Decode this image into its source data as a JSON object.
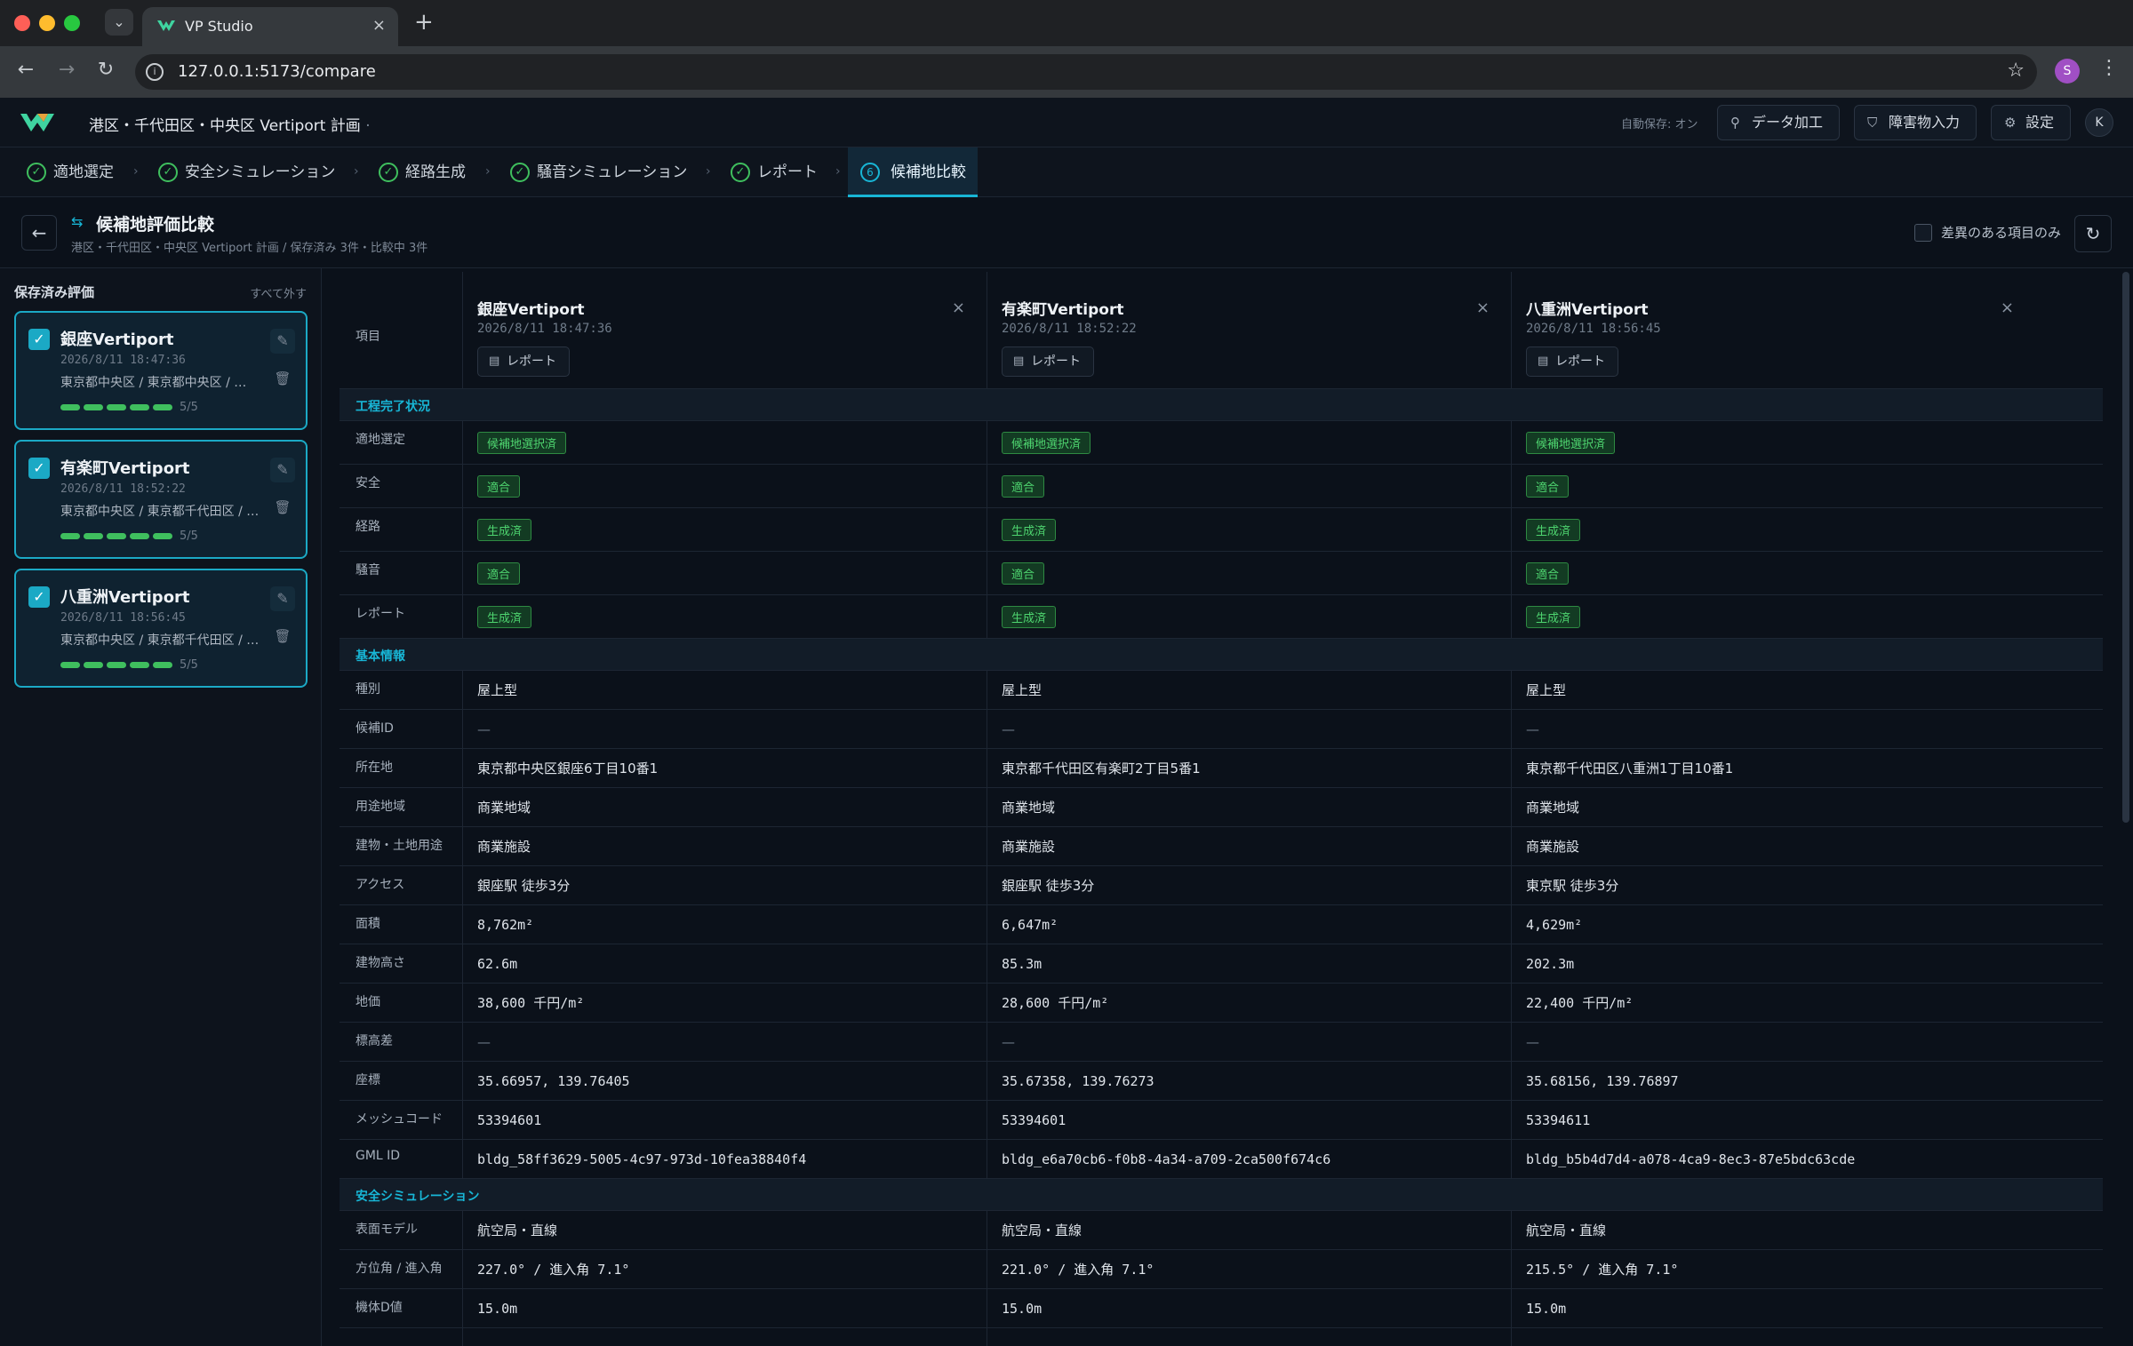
{
  "browser": {
    "tab_title": "VP Studio",
    "url": "127.0.0.1:5173/compare"
  },
  "app": {
    "project": "港区・千代田区・中央区 Vertiport 計画",
    "autosave": "自動保存: オン",
    "buttons": {
      "data": "データ加工",
      "obstacle": "障害物入力",
      "settings": "設定"
    },
    "avatar": "K",
    "profile": "S"
  },
  "steps": [
    {
      "label": "適地選定"
    },
    {
      "label": "安全シミュレーション"
    },
    {
      "label": "経路生成"
    },
    {
      "label": "騒音シミュレーション"
    },
    {
      "label": "レポート"
    },
    {
      "label": "候補地比較",
      "num": "6"
    }
  ],
  "page": {
    "title": "候補地評価比較",
    "subtitle": "港区・千代田区・中央区 Vertiport 計画 / 保存済み 3件・比較中 3件",
    "diff_only": "差異のある項目のみ"
  },
  "sidebar": {
    "title": "保存済み評価",
    "clear_all": "すべて外す",
    "cards": [
      {
        "name": "銀座Vertiport",
        "date": "2026/8/11 18:47:36",
        "addr": "東京都中央区 / 東京都中央区 / …",
        "progress": "5/5"
      },
      {
        "name": "有楽町Vertiport",
        "date": "2026/8/11 18:52:22",
        "addr": "東京都中央区 / 東京都千代田区 / …",
        "progress": "5/5"
      },
      {
        "name": "八重洲Vertiport",
        "date": "2026/8/11 18:56:45",
        "addr": "東京都中央区 / 東京都千代田区 / …",
        "progress": "5/5"
      }
    ]
  },
  "table": {
    "item_label": "項目",
    "report_btn": "レポート",
    "columns": [
      {
        "name": "銀座Vertiport",
        "date": "2026/8/11 18:47:36"
      },
      {
        "name": "有楽町Vertiport",
        "date": "2026/8/11 18:52:22"
      },
      {
        "name": "八重洲Vertiport",
        "date": "2026/8/11 18:56:45"
      }
    ],
    "sections": [
      {
        "title": "工程完了状況",
        "rows": [
          {
            "label": "適地選定",
            "badge": true,
            "values": [
              "候補地選択済",
              "候補地選択済",
              "候補地選択済"
            ]
          },
          {
            "label": "安全",
            "badge": true,
            "values": [
              "適合",
              "適合",
              "適合"
            ]
          },
          {
            "label": "経路",
            "badge": true,
            "values": [
              "生成済",
              "生成済",
              "生成済"
            ]
          },
          {
            "label": "騒音",
            "badge": true,
            "values": [
              "適合",
              "適合",
              "適合"
            ]
          },
          {
            "label": "レポート",
            "badge": true,
            "values": [
              "生成済",
              "生成済",
              "生成済"
            ]
          }
        ]
      },
      {
        "title": "基本情報",
        "rows": [
          {
            "label": "種別",
            "values": [
              "屋上型",
              "屋上型",
              "屋上型"
            ]
          },
          {
            "label": "候補ID",
            "values": [
              "—",
              "—",
              "—"
            ]
          },
          {
            "label": "所在地",
            "values": [
              "東京都中央区銀座6丁目10番1",
              "東京都千代田区有楽町2丁目5番1",
              "東京都千代田区八重洲1丁目10番1"
            ]
          },
          {
            "label": "用途地域",
            "values": [
              "商業地域",
              "商業地域",
              "商業地域"
            ]
          },
          {
            "label": "建物・土地用途",
            "values": [
              "商業施設",
              "商業施設",
              "商業施設"
            ]
          },
          {
            "label": "アクセス",
            "values": [
              "銀座駅 徒歩3分",
              "銀座駅 徒歩3分",
              "東京駅 徒歩3分"
            ]
          },
          {
            "label": "面積",
            "mono": true,
            "values": [
              "8,762m²",
              "6,647m²",
              "4,629m²"
            ]
          },
          {
            "label": "建物高さ",
            "mono": true,
            "values": [
              "62.6m",
              "85.3m",
              "202.3m"
            ]
          },
          {
            "label": "地価",
            "mono": true,
            "values": [
              "38,600 千円/m²",
              "28,600 千円/m²",
              "22,400 千円/m²"
            ]
          },
          {
            "label": "標高差",
            "values": [
              "—",
              "—",
              "—"
            ]
          },
          {
            "label": "座標",
            "mono": true,
            "values": [
              "35.66957, 139.76405",
              "35.67358, 139.76273",
              "35.68156, 139.76897"
            ]
          },
          {
            "label": "メッシュコード",
            "mono": true,
            "values": [
              "53394601",
              "53394601",
              "53394611"
            ]
          },
          {
            "label": "GML ID",
            "mono": true,
            "values": [
              "bldg_58ff3629-5005-4c97-973d-10fea38840f4",
              "bldg_e6a70cb6-f0b8-4a34-a709-2ca500f674c6",
              "bldg_b5b4d7d4-a078-4ca9-8ec3-87e5bdc63cde"
            ]
          }
        ]
      },
      {
        "title": "安全シミュレーション",
        "rows": [
          {
            "label": "表面モデル",
            "values": [
              "航空局・直線",
              "航空局・直線",
              "航空局・直線"
            ]
          },
          {
            "label": "方位角 / 進入角",
            "mono": true,
            "values": [
              "227.0° / 進入角 7.1°",
              "221.0° / 進入角 7.1°",
              "215.5° / 進入角 7.1°"
            ]
          },
          {
            "label": "機体D値",
            "mono": true,
            "values": [
              "15.0m",
              "15.0m",
              "15.0m"
            ]
          },
          {
            "label": "",
            "values": [
              "",
              "",
              ""
            ]
          }
        ]
      }
    ]
  }
}
